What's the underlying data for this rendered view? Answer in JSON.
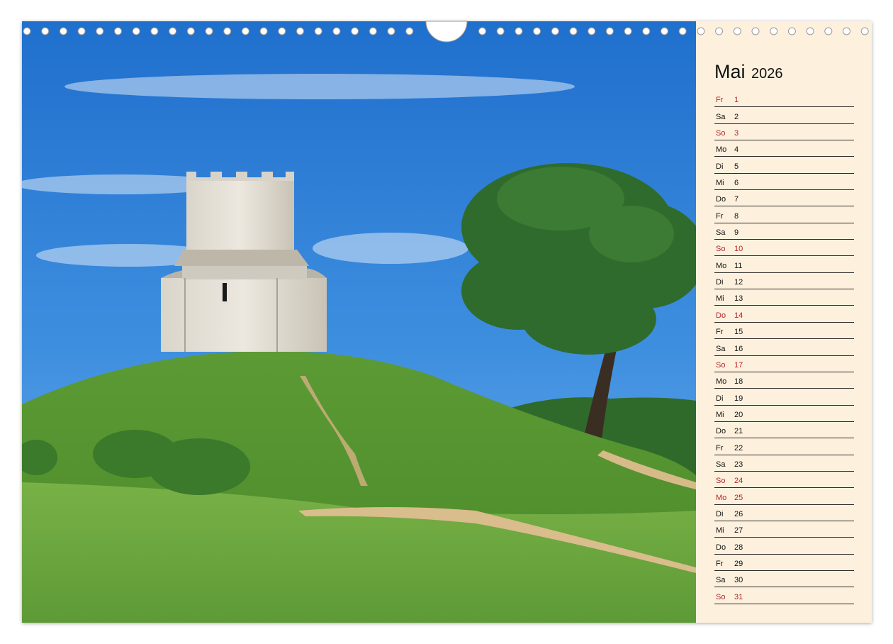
{
  "calendar": {
    "month": "Mai",
    "year": "2026",
    "days": [
      {
        "wd": "Fr",
        "d": "1",
        "red": true
      },
      {
        "wd": "Sa",
        "d": "2",
        "red": false
      },
      {
        "wd": "So",
        "d": "3",
        "red": true
      },
      {
        "wd": "Mo",
        "d": "4",
        "red": false
      },
      {
        "wd": "Di",
        "d": "5",
        "red": false
      },
      {
        "wd": "Mi",
        "d": "6",
        "red": false
      },
      {
        "wd": "Do",
        "d": "7",
        "red": false
      },
      {
        "wd": "Fr",
        "d": "8",
        "red": false
      },
      {
        "wd": "Sa",
        "d": "9",
        "red": false
      },
      {
        "wd": "So",
        "d": "10",
        "red": true
      },
      {
        "wd": "Mo",
        "d": "11",
        "red": false
      },
      {
        "wd": "Di",
        "d": "12",
        "red": false
      },
      {
        "wd": "Mi",
        "d": "13",
        "red": false
      },
      {
        "wd": "Do",
        "d": "14",
        "red": true
      },
      {
        "wd": "Fr",
        "d": "15",
        "red": false
      },
      {
        "wd": "Sa",
        "d": "16",
        "red": false
      },
      {
        "wd": "So",
        "d": "17",
        "red": true
      },
      {
        "wd": "Mo",
        "d": "18",
        "red": false
      },
      {
        "wd": "Di",
        "d": "19",
        "red": false
      },
      {
        "wd": "Mi",
        "d": "20",
        "red": false
      },
      {
        "wd": "Do",
        "d": "21",
        "red": false
      },
      {
        "wd": "Fr",
        "d": "22",
        "red": false
      },
      {
        "wd": "Sa",
        "d": "23",
        "red": false
      },
      {
        "wd": "So",
        "d": "24",
        "red": true
      },
      {
        "wd": "Mo",
        "d": "25",
        "red": true
      },
      {
        "wd": "Di",
        "d": "26",
        "red": false
      },
      {
        "wd": "Mi",
        "d": "27",
        "red": false
      },
      {
        "wd": "Do",
        "d": "28",
        "red": false
      },
      {
        "wd": "Fr",
        "d": "29",
        "red": false
      },
      {
        "wd": "Sa",
        "d": "30",
        "red": false
      },
      {
        "wd": "So",
        "d": "31",
        "red": true
      }
    ]
  },
  "colors": {
    "holiday_red": "#b3262a",
    "panel_bg": "#fdf1de",
    "sky": "#2f82d6",
    "grass": "#6aa63a"
  },
  "icons": {
    "binding_holes": "ring-hole-icon",
    "hanger": "hanger-notch-icon"
  }
}
